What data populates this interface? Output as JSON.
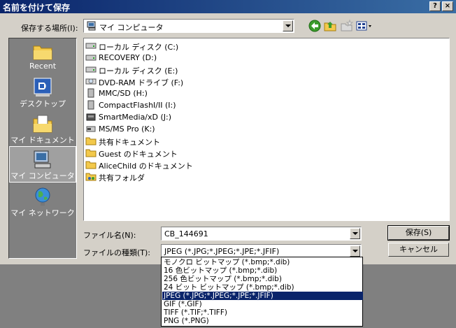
{
  "window": {
    "title": "名前を付けて保存",
    "help_label": "?",
    "close_label": "×"
  },
  "save_in": {
    "label": "保存する場所(I):",
    "value": "マイ コンピュータ"
  },
  "places": [
    {
      "label": "Recent",
      "icon": "recent-folder-icon"
    },
    {
      "label": "デスクトップ",
      "icon": "desktop-icon"
    },
    {
      "label": "マイ ドキュメント",
      "icon": "my-documents-icon"
    },
    {
      "label": "マイ コンピュータ",
      "icon": "my-computer-icon",
      "selected": true
    },
    {
      "label": "マイ ネットワーク",
      "icon": "network-globe-icon"
    }
  ],
  "files": [
    {
      "label": "ローカル ディスク (C:)",
      "icon": "hard-drive-icon"
    },
    {
      "label": "RECOVERY (D:)",
      "icon": "hard-drive-icon"
    },
    {
      "label": "ローカル ディスク (E:)",
      "icon": "hard-drive-icon"
    },
    {
      "label": "DVD-RAM ドライブ (F:)",
      "icon": "dvd-drive-icon"
    },
    {
      "label": "MMC/SD (H:)",
      "icon": "memory-card-icon"
    },
    {
      "label": "CompactFlashI/II (I:)",
      "icon": "memory-card-icon"
    },
    {
      "label": "SmartMedia/xD (J:)",
      "icon": "memory-card-icon"
    },
    {
      "label": "MS/MS Pro (K:)",
      "icon": "memory-card-icon"
    },
    {
      "label": "共有ドキュメント",
      "icon": "folder-icon"
    },
    {
      "label": "Guest のドキュメント",
      "icon": "folder-icon"
    },
    {
      "label": "AliceChild のドキュメント",
      "icon": "folder-icon"
    },
    {
      "label": "共有フォルダ",
      "icon": "shared-folder-icon"
    }
  ],
  "filename": {
    "label": "ファイル名(N):",
    "value": "CB_144691"
  },
  "filetype": {
    "label": "ファイルの種類(T):",
    "value": "JPEG (*.JPG;*.JPEG;*.JPE;*.JFIF)",
    "options": [
      "モノクロ ビットマップ (*.bmp;*.dib)",
      "16 色ビットマップ (*.bmp;*.dib)",
      "256 色ビットマップ (*.bmp;*.dib)",
      "24 ビット ビットマップ (*.bmp;*.dib)",
      "JPEG (*.JPG;*.JPEG;*.JPE;*.JFIF)",
      "GIF (*.GIF)",
      "TIFF (*.TIF;*.TIFF)",
      "PNG (*.PNG)"
    ],
    "selected_index": 4
  },
  "buttons": {
    "save": "保存(S)",
    "cancel": "キャンセル"
  },
  "colors": {
    "title_bar": "#0a246a",
    "selection": "#0a246a",
    "face": "#d4d0c8"
  }
}
